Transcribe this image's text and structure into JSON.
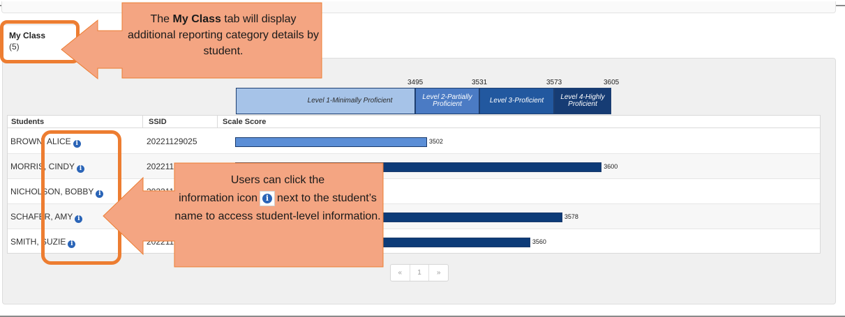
{
  "tab": {
    "title": "My Class",
    "count": "(5)"
  },
  "bands": {
    "cut_scores": [
      "3495",
      "3531",
      "3573",
      "3605"
    ],
    "levels": [
      "Level 1-Minimally Proficient",
      "Level 2-Partially Proficient",
      "Level 3-Proficient",
      "Level 4-Highly Proficient"
    ],
    "colors": [
      "#a6c3e8",
      "#4b7bc4",
      "#22589f",
      "#163c74"
    ]
  },
  "table": {
    "columns": [
      "Students",
      "SSID",
      "Scale Score"
    ],
    "rows": [
      {
        "name": "BROWN, ALICE",
        "ssid": "20221129025",
        "score": "3502",
        "score_value": 3502,
        "bar_color": "#5b8ed6"
      },
      {
        "name": "MORRIS, CINDY",
        "ssid": "2022112",
        "score": "3600",
        "score_value": 3600,
        "bar_color": "#0d3b78"
      },
      {
        "name": "NICHOLSON, BOBBY",
        "ssid": "2022112",
        "score": "",
        "score_value": null,
        "bar_color": ""
      },
      {
        "name": "SCHAFER, AMY",
        "ssid": "2022112",
        "score": "3578",
        "score_value": 3578,
        "bar_color": "#0d3b78"
      },
      {
        "name": "SMITH, SUZIE",
        "ssid": "2022112",
        "score": "3560",
        "score_value": 3560,
        "bar_color": "#0d3b78"
      }
    ],
    "info_icon": "info-icon"
  },
  "pagination": {
    "prev": "«",
    "page": "1",
    "next": "»"
  },
  "callouts": {
    "tab_note": {
      "pre": "The ",
      "bold": "My Class",
      "post": " tab will display additional reporting category details by student."
    },
    "icon_note": {
      "line1": "Users can click the",
      "pre": "information icon",
      "post": "next to the student’s name to access student-level information."
    }
  },
  "colors": {
    "callout_fill": "#f4a582",
    "callout_border": "#ed7d31"
  }
}
